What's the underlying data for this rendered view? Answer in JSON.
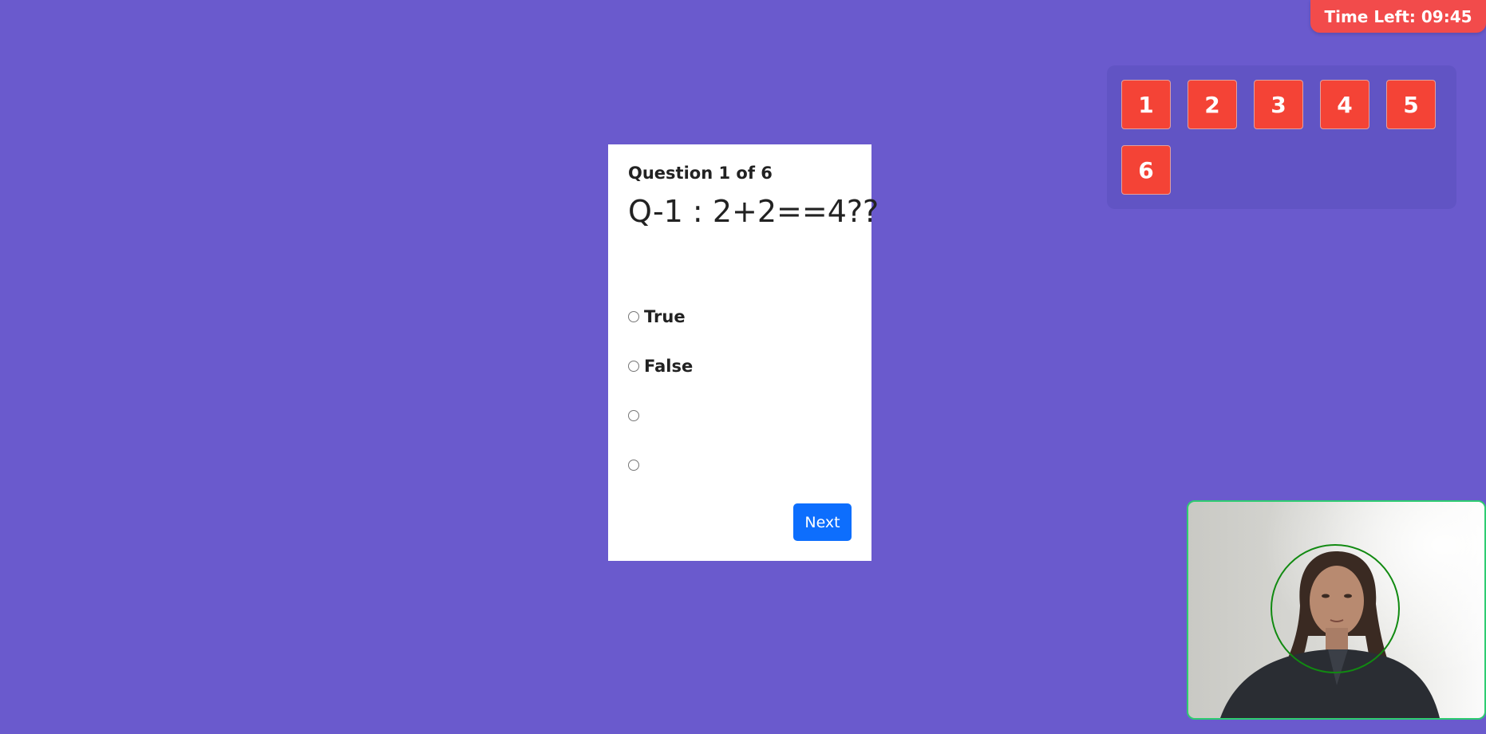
{
  "timer": {
    "label": "Time Left: 09:45"
  },
  "nav": {
    "questions": [
      "1",
      "2",
      "3",
      "4",
      "5",
      "6"
    ],
    "button_color": "#f44336"
  },
  "quiz": {
    "counter": "Question 1 of 6",
    "question": "Q-1 : 2+2==4??",
    "options": [
      "True",
      "False",
      "",
      ""
    ],
    "next_label": "Next"
  },
  "colors": {
    "background": "#6a5acd",
    "timer_bg": "#f24b4b",
    "next_button": "#0d6efd",
    "webcam_border": "#2ecc71",
    "face_ring": "#118a11"
  },
  "webcam": {
    "icon": "webcam-feed"
  }
}
